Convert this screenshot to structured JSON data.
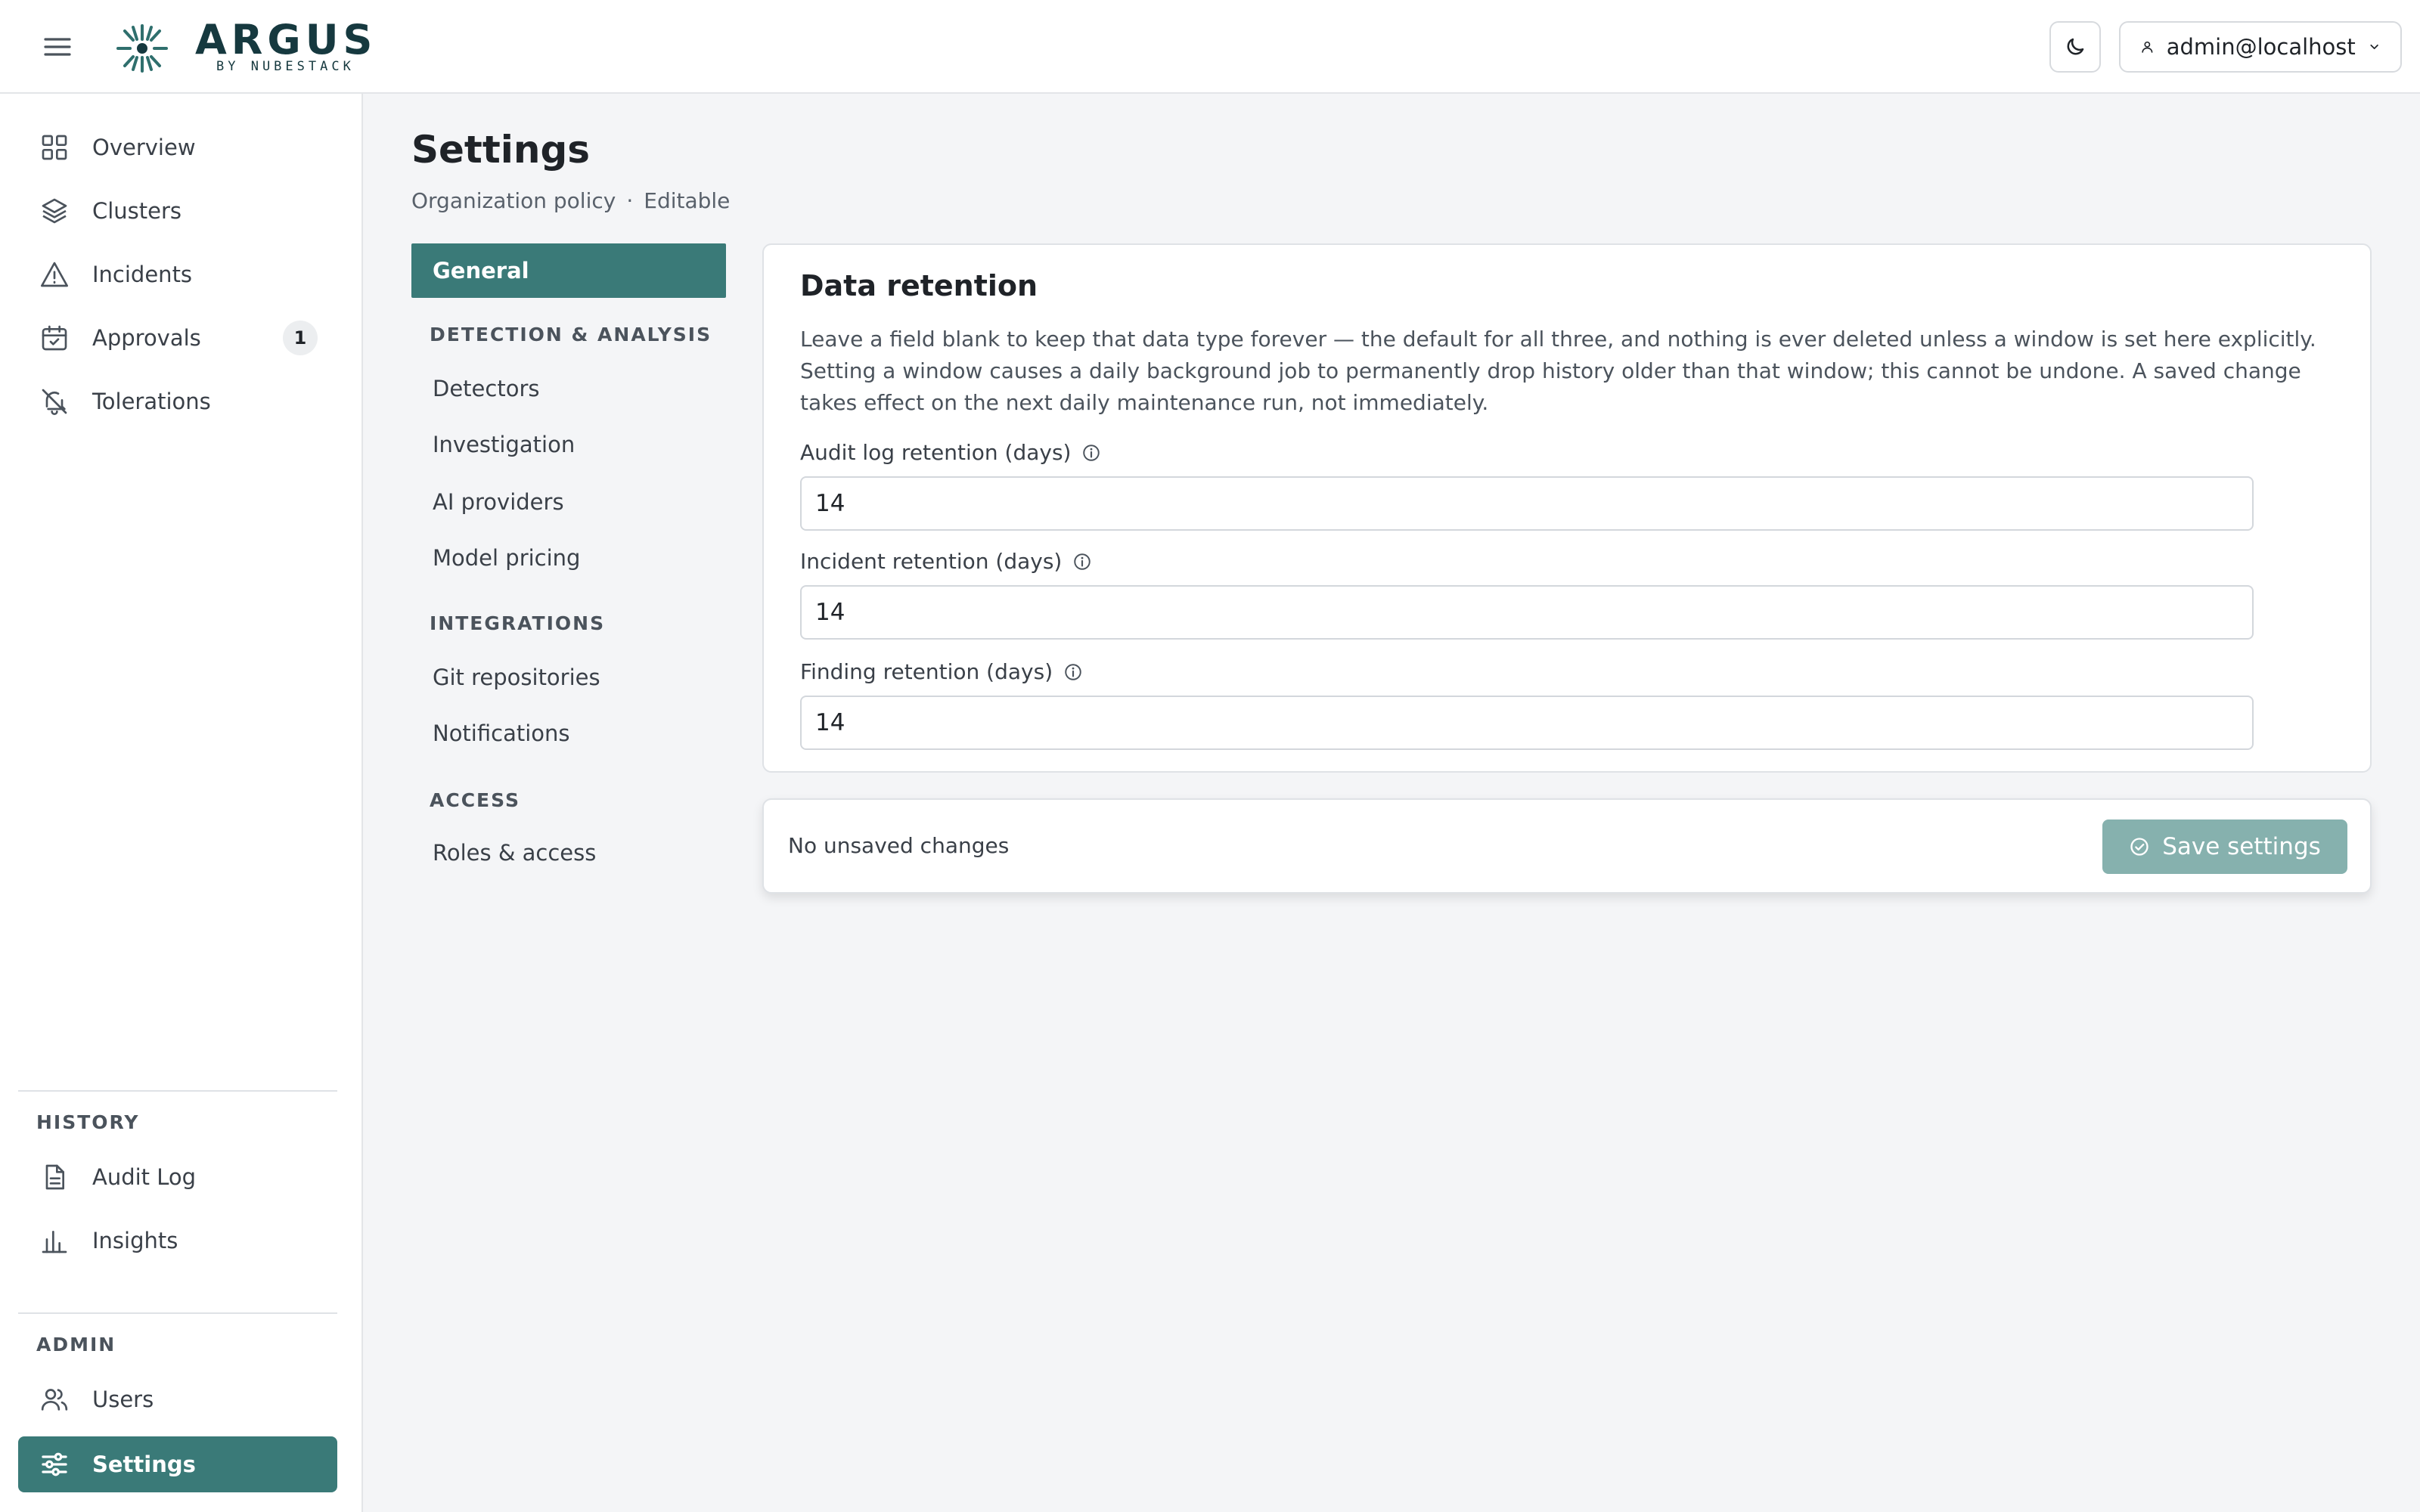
{
  "app": {
    "brand": "ARGUS",
    "brand_sub": "BY NUBESTACK"
  },
  "header": {
    "user_label": "admin@localhost",
    "icons": [
      "menu-icon",
      "moon-icon",
      "user-icon",
      "chevron-down-icon"
    ]
  },
  "sidebar": {
    "items": [
      {
        "label": "Overview",
        "icon": "grid-icon"
      },
      {
        "label": "Clusters",
        "icon": "layers-icon"
      },
      {
        "label": "Incidents",
        "icon": "alert-triangle-icon"
      },
      {
        "label": "Approvals",
        "icon": "calendar-check-icon",
        "badge": "1"
      },
      {
        "label": "Tolerations",
        "icon": "bell-off-icon"
      }
    ],
    "history": {
      "title": "HISTORY",
      "items": [
        {
          "label": "Audit Log",
          "icon": "file-text-icon"
        },
        {
          "label": "Insights",
          "icon": "bar-chart-icon"
        }
      ]
    },
    "admin": {
      "title": "ADMIN",
      "items": [
        {
          "label": "Users",
          "icon": "users-icon"
        },
        {
          "label": "Settings",
          "icon": "sliders-icon",
          "active": true
        }
      ]
    }
  },
  "page": {
    "title": "Settings",
    "subtitle_left": "Organization policy",
    "subtitle_sep": "·",
    "subtitle_right": "Editable"
  },
  "settings_nav": {
    "general": "General",
    "sections": [
      {
        "title": "DETECTION & ANALYSIS",
        "items": [
          "Detectors",
          "Investigation",
          "AI providers",
          "Model pricing"
        ]
      },
      {
        "title": "INTEGRATIONS",
        "items": [
          "Git repositories",
          "Notifications"
        ]
      },
      {
        "title": "ACCESS",
        "items": [
          "Roles & access"
        ]
      }
    ]
  },
  "retention": {
    "title": "Data retention",
    "description": "Leave a field blank to keep that data type forever — the default for all three, and nothing is ever deleted unless a window is set here explicitly. Setting a window causes a daily background job to permanently drop history older than that window; this cannot be undone. A saved change takes effect on the next daily maintenance run, not immediately.",
    "fields": [
      {
        "label": "Audit log retention (days)",
        "value": "14"
      },
      {
        "label": "Incident retention (days)",
        "value": "14"
      },
      {
        "label": "Finding retention (days)",
        "value": "14"
      }
    ]
  },
  "savebar": {
    "status": "No unsaved changes",
    "save_label": "Save settings"
  },
  "colors": {
    "accent": "#3a7a78",
    "accent_disabled": "#86b1ae",
    "brand_dark": "#16393f"
  }
}
